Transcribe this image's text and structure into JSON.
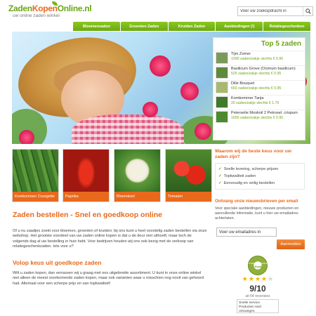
{
  "header": {
    "logo_part1": "Zaden",
    "logo_part2": "Kopen",
    "logo_part3": "Online.nl",
    "logo_tagline": "uw online zaden winkel",
    "search_placeholder": "Voer uw zoekopdracht in"
  },
  "nav": [
    {
      "label": "Bloemenzaden"
    },
    {
      "label": "Groenten Zaden"
    },
    {
      "label": "Kruiden Zaden"
    },
    {
      "label": "Aanbiedingen (!)"
    },
    {
      "label": "Relatiegeschenken"
    }
  ],
  "top5": {
    "title": "Top 5 zaden",
    "items": [
      {
        "name": "Tijm Zomer",
        "price": "1000 zaden/zakje slechts € 0.95",
        "color": "#7a9a5a"
      },
      {
        "name": "Basilicum Grove (Ocimum basilicum)",
        "price": "525 zaden/zakje slechts € 0.95",
        "color": "#5f8a3a"
      },
      {
        "name": "Dille Bouquet",
        "price": "650 zaden/zakje slechts € 0.95",
        "color": "#a8b870"
      },
      {
        "name": "Komkommer Tanja",
        "price": "20 zaden/zakje slechts € 1.75",
        "color": "#3f7a2a"
      },
      {
        "name": "Peterselie Mosknil 2 Petrosel. crispum",
        "price": "1650 zaden/zakje slechts € 0.95",
        "color": "#4c8a30"
      }
    ]
  },
  "categories": [
    {
      "label": "Komkommer Courgette"
    },
    {
      "label": "Paprika"
    },
    {
      "label": "Bloemkool"
    },
    {
      "label": "Tomaten"
    }
  ],
  "why": {
    "title": "Waarom wij de beste keus voor uw zaden zijn?",
    "items": [
      "Snelle levering, scherpe prijzen",
      "Topkwaliteit zaden",
      "Eenvoudig en veilig bestellen"
    ]
  },
  "newsletter": {
    "title": "Ontvang onze nieuwsbrieven per email",
    "text": "Voor speciale aanbiedingen, nieuwe producten en aanvullende informatie, kunt u hier uw emailadres achterlaten.",
    "input_value": "Voer uw emailadres in",
    "button": "Aanmelden"
  },
  "review": {
    "seal_top": "ONDERSCHEIDING",
    "seal_brand": "Kiyoh",
    "score": "9/10",
    "count": "uit 64 recensies",
    "quote": "Snelle service. Producten snel ontvangen."
  },
  "main": {
    "h1": "Zaden bestellen - Snel en goedkoop online",
    "p1": "Of u nu zaadjes zoekt voor bloemen, groenten of kruiden: bij ons kunt u heel voordelig zaden bestellen via onze webshop. Het grootste voordeel van uw zaden online kopen is dat u de deur niet uithoeft, maar toch de volgende dag al uw bestelling in huis hebt. Voor bedrijven houden wij ons ook bezig met de verkoop van relatiegeschenkzaden. Iets voor u?",
    "h2": "Volop keus uit goedkope zaden",
    "p2": "Wilt u zaden kopen, dan verrassen wij u graag met ons uitgebreide assortiment. U kunt in onze online winkel niet alleen de meest voorkomende zaden kopen, maar ook varianten waar u misschien nog nooit van gehoord had. Allemaal voor een scherpe prijs en van topkwaliteit!"
  },
  "colors": {
    "brand_green": "#6aa614",
    "accent_orange": "#e8691c"
  }
}
